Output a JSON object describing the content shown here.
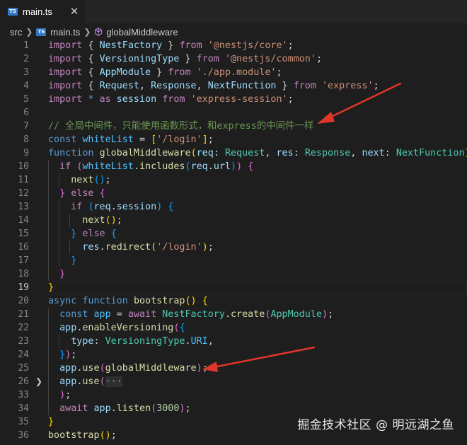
{
  "tab": {
    "badge": "TS",
    "label": "main.ts",
    "close_glyph": "✕"
  },
  "breadcrumb": {
    "folder": "src",
    "file_badge": "TS",
    "file": "main.ts",
    "symbol": "globalMiddleware"
  },
  "lines": [
    {
      "n": "1",
      "tokens": [
        [
          "import ",
          "c"
        ],
        [
          "{ ",
          "p"
        ],
        [
          "NestFactory",
          "v"
        ],
        [
          " } ",
          "p"
        ],
        [
          "from ",
          "c"
        ],
        [
          "'@nestjs/core'",
          "s"
        ],
        [
          ";",
          "p"
        ]
      ]
    },
    {
      "n": "2",
      "tokens": [
        [
          "import ",
          "c"
        ],
        [
          "{ ",
          "p"
        ],
        [
          "VersioningType",
          "v"
        ],
        [
          " } ",
          "p"
        ],
        [
          "from ",
          "c"
        ],
        [
          "'@nestjs/common'",
          "s"
        ],
        [
          ";",
          "p"
        ]
      ]
    },
    {
      "n": "3",
      "tokens": [
        [
          "import ",
          "c"
        ],
        [
          "{ ",
          "p"
        ],
        [
          "AppModule",
          "v"
        ],
        [
          " } ",
          "p"
        ],
        [
          "from ",
          "c"
        ],
        [
          "'./app.module'",
          "s"
        ],
        [
          ";",
          "p"
        ]
      ]
    },
    {
      "n": "4",
      "tokens": [
        [
          "import ",
          "c"
        ],
        [
          "{ ",
          "p"
        ],
        [
          "Request",
          "v"
        ],
        [
          ", ",
          "p"
        ],
        [
          "Response",
          "v"
        ],
        [
          ", ",
          "p"
        ],
        [
          "NextFunction",
          "v"
        ],
        [
          " } ",
          "p"
        ],
        [
          "from ",
          "c"
        ],
        [
          "'express'",
          "s"
        ],
        [
          ";",
          "p"
        ]
      ]
    },
    {
      "n": "5",
      "tokens": [
        [
          "import ",
          "c"
        ],
        [
          "* ",
          "k"
        ],
        [
          "as ",
          "c"
        ],
        [
          "session ",
          "v"
        ],
        [
          "from ",
          "c"
        ],
        [
          "'express-session'",
          "s"
        ],
        [
          ";",
          "p"
        ]
      ]
    },
    {
      "n": "6",
      "tokens": []
    },
    {
      "n": "7",
      "tokens": [
        [
          "// 全局中间件，只能使用函数形式，和express的中间件一样",
          "cm"
        ]
      ]
    },
    {
      "n": "8",
      "tokens": [
        [
          "const ",
          "k"
        ],
        [
          "whiteList",
          "cn"
        ],
        [
          " = ",
          "p"
        ],
        [
          "[",
          "b1"
        ],
        [
          "'/login'",
          "s"
        ],
        [
          "]",
          "b1"
        ],
        [
          ";",
          "p"
        ]
      ]
    },
    {
      "n": "9",
      "tokens": [
        [
          "function ",
          "k"
        ],
        [
          "globalMiddleware",
          "f"
        ],
        [
          "(",
          "b1"
        ],
        [
          "req",
          "v"
        ],
        [
          ": ",
          "p"
        ],
        [
          "Request",
          "t"
        ],
        [
          ", ",
          "p"
        ],
        [
          "res",
          "v"
        ],
        [
          ": ",
          "p"
        ],
        [
          "Response",
          "t"
        ],
        [
          ", ",
          "p"
        ],
        [
          "next",
          "v"
        ],
        [
          ": ",
          "p"
        ],
        [
          "NextFunction",
          "t"
        ],
        [
          ") ",
          "b1"
        ],
        [
          "{",
          "b1"
        ]
      ]
    },
    {
      "n": "10",
      "tokens": [
        [
          "  if ",
          "c"
        ],
        [
          "(",
          "b2"
        ],
        [
          "whiteList",
          "cn"
        ],
        [
          ".",
          "p"
        ],
        [
          "includes",
          "f"
        ],
        [
          "(",
          "b3"
        ],
        [
          "req",
          "v"
        ],
        [
          ".",
          "p"
        ],
        [
          "url",
          "v"
        ],
        [
          ")",
          "b3"
        ],
        [
          ") ",
          "b2"
        ],
        [
          "{",
          "b2"
        ]
      ]
    },
    {
      "n": "11",
      "tokens": [
        [
          "    next",
          "f"
        ],
        [
          "(",
          "b3"
        ],
        [
          ")",
          "b3"
        ],
        [
          ";",
          "p"
        ]
      ]
    },
    {
      "n": "12",
      "tokens": [
        [
          "  }",
          "b2"
        ],
        [
          " else ",
          "c"
        ],
        [
          "{",
          "b2"
        ]
      ]
    },
    {
      "n": "13",
      "tokens": [
        [
          "    if ",
          "c"
        ],
        [
          "(",
          "b3"
        ],
        [
          "req",
          "v"
        ],
        [
          ".",
          "p"
        ],
        [
          "session",
          "v"
        ],
        [
          ") ",
          "b3"
        ],
        [
          "{",
          "b3"
        ]
      ]
    },
    {
      "n": "14",
      "tokens": [
        [
          "      next",
          "f"
        ],
        [
          "(",
          "b1"
        ],
        [
          ")",
          "b1"
        ],
        [
          ";",
          "p"
        ]
      ]
    },
    {
      "n": "15",
      "tokens": [
        [
          "    }",
          "b3"
        ],
        [
          " else ",
          "c"
        ],
        [
          "{",
          "b3"
        ]
      ]
    },
    {
      "n": "16",
      "tokens": [
        [
          "      res",
          "v"
        ],
        [
          ".",
          "p"
        ],
        [
          "redirect",
          "f"
        ],
        [
          "(",
          "b1"
        ],
        [
          "'/login'",
          "s"
        ],
        [
          ")",
          "b1"
        ],
        [
          ";",
          "p"
        ]
      ]
    },
    {
      "n": "17",
      "tokens": [
        [
          "    }",
          "b3"
        ]
      ]
    },
    {
      "n": "18",
      "tokens": [
        [
          "  }",
          "b2"
        ]
      ]
    },
    {
      "n": "19",
      "tokens": [
        [
          "}",
          "b1"
        ]
      ]
    },
    {
      "n": "20",
      "tokens": [
        [
          "async ",
          "k"
        ],
        [
          "function ",
          "k"
        ],
        [
          "bootstrap",
          "f"
        ],
        [
          "() ",
          "b1"
        ],
        [
          "{",
          "b1"
        ]
      ]
    },
    {
      "n": "21",
      "tokens": [
        [
          "  const ",
          "k"
        ],
        [
          "app",
          "cn"
        ],
        [
          " = ",
          "p"
        ],
        [
          "await ",
          "c"
        ],
        [
          "NestFactory",
          "t"
        ],
        [
          ".",
          "p"
        ],
        [
          "create",
          "f"
        ],
        [
          "(",
          "b2"
        ],
        [
          "AppModule",
          "t"
        ],
        [
          ")",
          "b2"
        ],
        [
          ";",
          "p"
        ]
      ]
    },
    {
      "n": "22",
      "tokens": [
        [
          "  app",
          "v"
        ],
        [
          ".",
          "p"
        ],
        [
          "enableVersioning",
          "f"
        ],
        [
          "(",
          "b2"
        ],
        [
          "{",
          "b3"
        ]
      ]
    },
    {
      "n": "23",
      "tokens": [
        [
          "    type",
          "v"
        ],
        [
          ": ",
          "p"
        ],
        [
          "VersioningType",
          "t"
        ],
        [
          ".",
          "p"
        ],
        [
          "URI",
          "cn"
        ],
        [
          ",",
          "p"
        ]
      ]
    },
    {
      "n": "24",
      "tokens": [
        [
          "  }",
          "b3"
        ],
        [
          ")",
          "b2"
        ],
        [
          ";",
          "p"
        ]
      ]
    },
    {
      "n": "25",
      "tokens": [
        [
          "  app",
          "v"
        ],
        [
          ".",
          "p"
        ],
        [
          "use",
          "f"
        ],
        [
          "(",
          "b2"
        ],
        [
          "globalMiddleware",
          "f"
        ],
        [
          ")",
          "b2"
        ],
        [
          ";",
          "p"
        ]
      ]
    },
    {
      "n": "26",
      "tokens": [
        [
          "  app",
          "v"
        ],
        [
          ".",
          "p"
        ],
        [
          "use",
          "f"
        ],
        [
          "(",
          "b2"
        ],
        [
          "···",
          "ph"
        ]
      ]
    },
    {
      "n": "33",
      "tokens": [
        [
          "  )",
          "b2"
        ],
        [
          ";",
          "p"
        ]
      ]
    },
    {
      "n": "34",
      "tokens": [
        [
          "  await ",
          "c"
        ],
        [
          "app",
          "v"
        ],
        [
          ".",
          "p"
        ],
        [
          "listen",
          "f"
        ],
        [
          "(",
          "b2"
        ],
        [
          "3000",
          "n"
        ],
        [
          ")",
          "b2"
        ],
        [
          ";",
          "p"
        ]
      ]
    },
    {
      "n": "35",
      "tokens": [
        [
          "}",
          "b1"
        ]
      ]
    },
    {
      "n": "36",
      "tokens": [
        [
          "bootstrap",
          "f"
        ],
        [
          "()",
          "b1"
        ],
        [
          ";",
          "p"
        ]
      ]
    }
  ],
  "active_line": "19",
  "folded_line": "26",
  "icons": {
    "fold": "chevron-right-icon",
    "ts": "typescript-file-icon",
    "symbol": "symbol-method-cube-icon"
  },
  "watermark": "掘金技术社区 @ 明远湖之鱼",
  "colors": {
    "background": "#1e1e1e",
    "arrow": "#e0352b",
    "accent": "#3178c6"
  }
}
